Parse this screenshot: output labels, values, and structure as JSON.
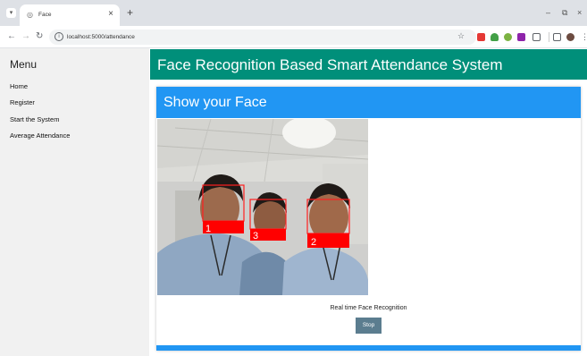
{
  "browser": {
    "tab_title": "Face",
    "tab_close": "×",
    "new_tab": "+",
    "url": "localhost:5000/attendance",
    "window_controls": {
      "minimize": "–",
      "restore": "⧉",
      "close": "×"
    },
    "extension_colors": [
      "#e53935",
      "#43a047",
      "#7cb342",
      "#8e24aa",
      "#6d4c41"
    ]
  },
  "sidebar": {
    "title": "Menu",
    "items": [
      {
        "label": "Home"
      },
      {
        "label": "Register"
      },
      {
        "label": "Start the System"
      },
      {
        "label": "Average Attendance"
      }
    ]
  },
  "header": {
    "title": "Face Recognition Based Smart Attendance System",
    "color": "#008f7a"
  },
  "card": {
    "title": "Show your Face",
    "accent": "#2196f3",
    "caption": "Real time Face Recognition",
    "stop_label": "Stop"
  },
  "feed": {
    "detections": [
      {
        "label": "1",
        "box_color": "#ff0000"
      },
      {
        "label": "3",
        "box_color": "#ff0000"
      },
      {
        "label": "2",
        "box_color": "#ff0000"
      }
    ]
  }
}
